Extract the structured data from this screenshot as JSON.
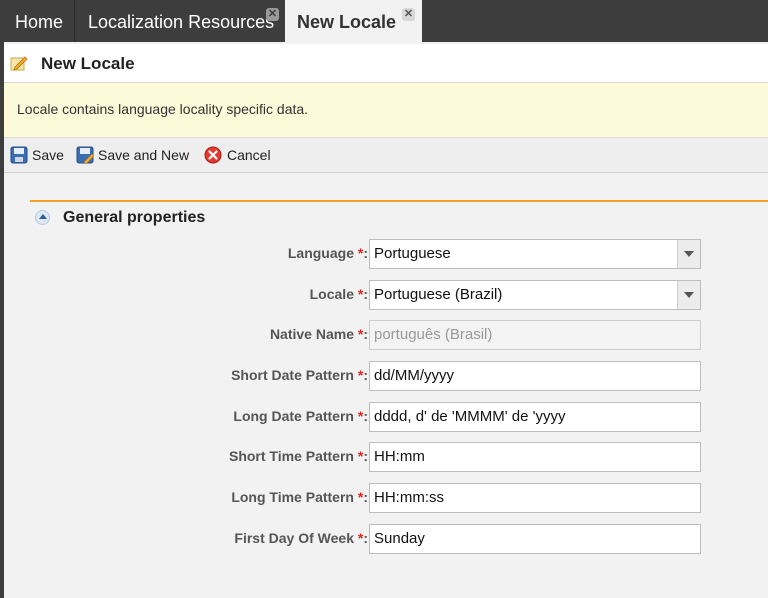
{
  "tabs": [
    {
      "label": "Home"
    },
    {
      "label": "Localization Resources",
      "close": "✕"
    },
    {
      "label": "New Locale",
      "close": "✕",
      "active": true
    }
  ],
  "page": {
    "title": "New Locale",
    "icon": "edit-note-icon"
  },
  "info": {
    "text": "Locale contains language locality specific data."
  },
  "toolbar": {
    "save": "Save",
    "save_and_new": "Save and New",
    "cancel": "Cancel"
  },
  "section": {
    "title": "General properties"
  },
  "required_marker": "*",
  "fields": {
    "language": {
      "label": "Language ",
      "value": "Portuguese"
    },
    "locale": {
      "label": "Locale ",
      "value": "Portuguese (Brazil)"
    },
    "native_name": {
      "label": "Native Name ",
      "value": "português (Brasil)"
    },
    "short_date": {
      "label": "Short Date Pattern ",
      "value": "dd/MM/yyyy"
    },
    "long_date": {
      "label": "Long Date Pattern ",
      "value": "dddd, d' de 'MMMM' de 'yyyy"
    },
    "short_time": {
      "label": "Short Time Pattern ",
      "value": "HH:mm"
    },
    "long_time": {
      "label": "Long Time Pattern ",
      "value": "HH:mm:ss"
    },
    "first_day": {
      "label": "First Day Of Week ",
      "value": "Sunday"
    }
  },
  "colors": {
    "accent": "#f2a22a",
    "required": "#e3231c",
    "info_bg": "#fcfad8"
  }
}
